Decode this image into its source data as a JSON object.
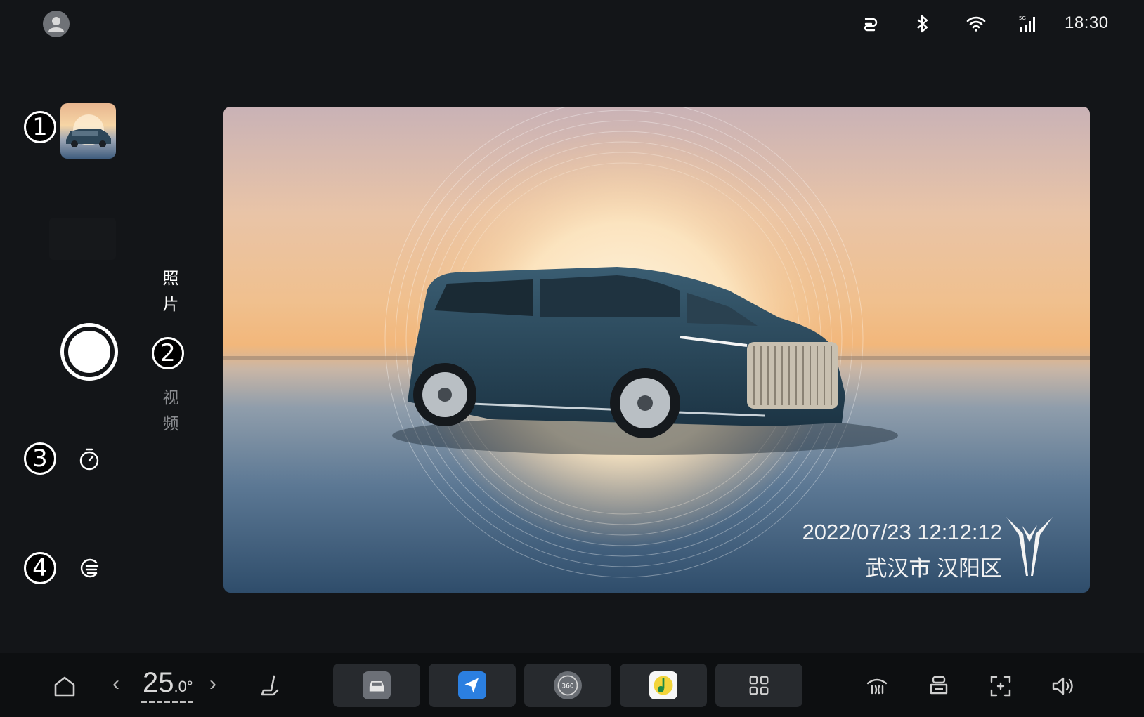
{
  "status_bar": {
    "clock": "18:30",
    "icons": [
      "hotspot-icon",
      "bluetooth-icon",
      "wifi-icon",
      "cellular-5g-icon"
    ]
  },
  "left_panel": {
    "badges": [
      "1",
      "2",
      "3",
      "4"
    ],
    "modes": {
      "photo": "照片",
      "video": "视频",
      "selected": "photo"
    },
    "icons": [
      "gallery-thumbnail",
      "shutter-button",
      "timer-icon",
      "filter-icon"
    ]
  },
  "preview": {
    "timestamp": "2022/07/23 12:12:12",
    "location": "武汉市 汉阳区"
  },
  "dock": {
    "temperature": {
      "value": "25",
      "decimal": ".0",
      "unit": "°"
    },
    "apps": [
      "car-app",
      "navigation-app",
      "camera-360-app",
      "music-app",
      "app-grid"
    ],
    "right_icons": [
      "rear-defrost-icon",
      "seat-icon",
      "screen-icon",
      "volume-icon"
    ]
  },
  "colors": {
    "background": "#131518",
    "dock": "#0d0f11",
    "tile": "#272a2e",
    "nav_blue": "#2b7fe0",
    "music_yellow": "#f2d43a"
  }
}
